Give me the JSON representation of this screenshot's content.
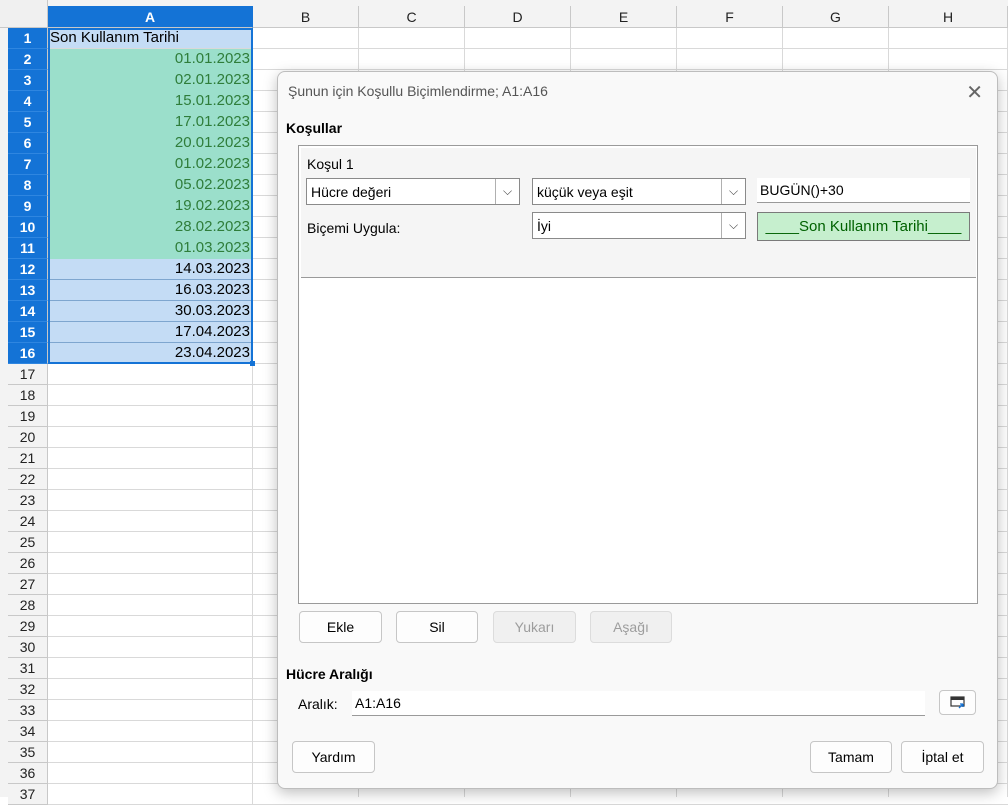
{
  "sheet": {
    "columns": [
      "A",
      "B",
      "C",
      "D",
      "E",
      "F",
      "G",
      "H"
    ],
    "rows": [
      "1",
      "2",
      "3",
      "4",
      "5",
      "6",
      "7",
      "8",
      "9",
      "10",
      "11",
      "12",
      "13",
      "14",
      "15",
      "16",
      "17",
      "18",
      "19",
      "20",
      "21",
      "22",
      "23",
      "24",
      "25",
      "26",
      "27",
      "28",
      "29",
      "30",
      "31",
      "32",
      "33",
      "34",
      "35",
      "36",
      "37"
    ],
    "a_values": [
      "Son Kullanım Tarihi",
      "01.01.2023",
      "02.01.2023",
      "15.01.2023",
      "17.01.2023",
      "20.01.2023",
      "01.02.2023",
      "05.02.2023",
      "19.02.2023",
      "28.02.2023",
      "01.03.2023",
      "14.03.2023",
      "16.03.2023",
      "30.03.2023",
      "17.04.2023",
      "23.04.2023"
    ],
    "highlight_color": "#9bdfcb",
    "selection_color": "#1473d6"
  },
  "dialog": {
    "title": "Şunun için Koşullu Biçimlendirme; A1:A16",
    "conditions_label": "Koşullar",
    "condition_heading": "Koşul 1",
    "type_value": "Hücre değeri",
    "operator_value": "küçük veya eşit",
    "formula_value": "BUGÜN()+30",
    "apply_style_label": "Biçemi Uygula:",
    "style_value": "İyi",
    "preview_text": "____Son Kullanım Tarihi____",
    "buttons": {
      "add": "Ekle",
      "delete": "Sil",
      "up": "Yukarı",
      "down": "Aşağı",
      "help": "Yardım",
      "ok": "Tamam",
      "cancel": "İptal et"
    },
    "range_section_label": "Hücre Aralığı",
    "range_label": "Aralık:",
    "range_value": "A1:A16"
  }
}
